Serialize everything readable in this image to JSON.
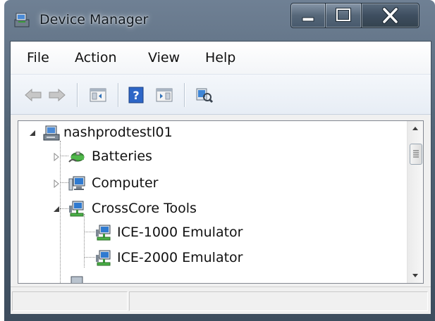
{
  "window": {
    "title": "Device Manager",
    "controls": [
      "minimize",
      "maximize",
      "close"
    ]
  },
  "menu": {
    "file": "File",
    "action": "Action",
    "view": "View",
    "help": "Help"
  },
  "toolbar": {
    "buttons": [
      "back-arrow-icon",
      "forward-arrow-icon",
      "show-hide-console-tree-icon",
      "help-icon",
      "show-hide-action-pane-icon",
      "scan-hardware-icon"
    ]
  },
  "tree": {
    "root": {
      "label": "nashprodtestl01",
      "expanded": true
    },
    "items": [
      {
        "label": "Batteries",
        "expanded": false
      },
      {
        "label": "Computer",
        "expanded": false
      },
      {
        "label": "CrossCore Tools",
        "expanded": true,
        "children": [
          {
            "label": "ICE-1000 Emulator"
          },
          {
            "label": "ICE-2000 Emulator"
          }
        ]
      }
    ]
  },
  "statusbar": {
    "panes": [
      "",
      ""
    ]
  }
}
